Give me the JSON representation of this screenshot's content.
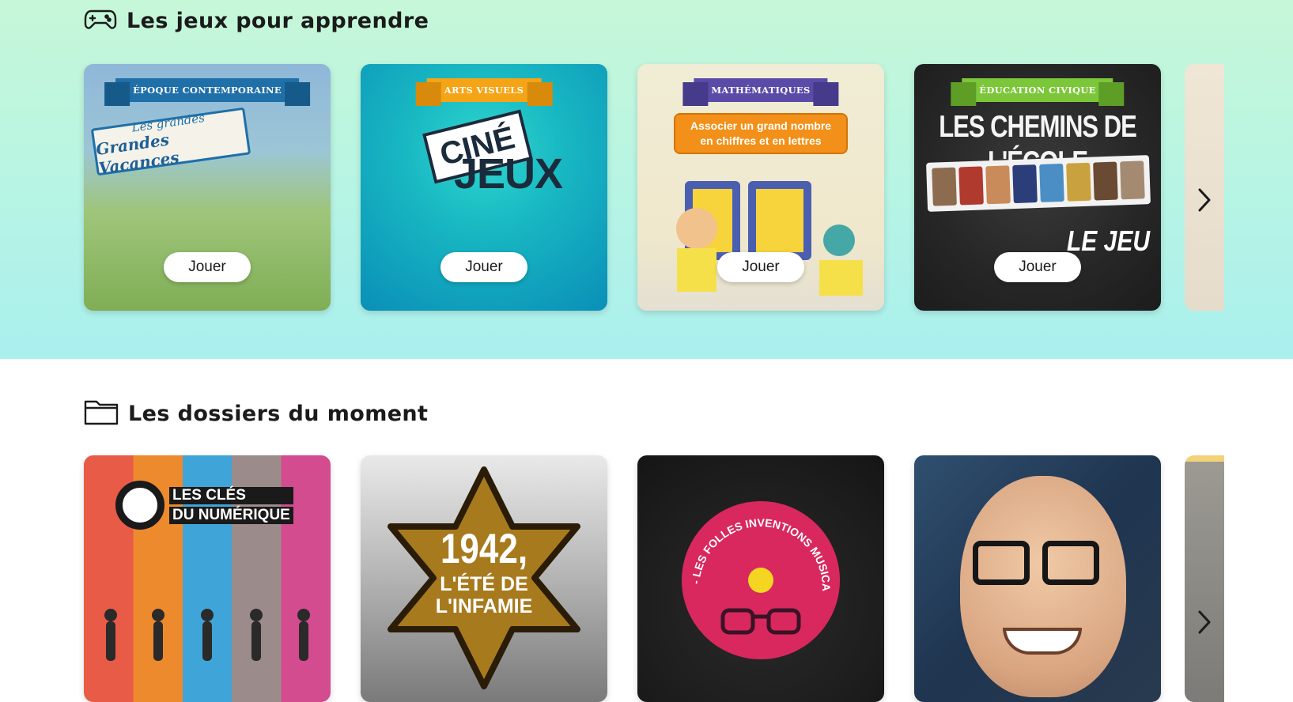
{
  "games": {
    "title": "Les jeux pour apprendre",
    "play_label": "Jouer",
    "cards": [
      {
        "category": "ÉPOQUE CONTEMPORAINE",
        "line1": "Les grandes",
        "line2": "Grandes Vacances"
      },
      {
        "category": "ARTS VISUELS",
        "word1": "CINÉ",
        "word2": "JEUX"
      },
      {
        "category": "MATHÉMATIQUES",
        "line1": "Associer un grand nombre",
        "line2": "en chiffres et en lettres"
      },
      {
        "category": "ÉDUCATION CIVIQUE",
        "title": "LES CHEMINS DE L'ÉCOLE",
        "subtitle": "LE JEU"
      }
    ]
  },
  "dossiers": {
    "title": "Les dossiers du moment",
    "cards": [
      {
        "line1": "LES CLÉS",
        "line2": "DU NUMÉRIQUE"
      },
      {
        "year": "1942,",
        "line1": "L'ÉTÉ DE",
        "line2": "L'INFAMIE"
      },
      {
        "curved": "- LES FOLLES INVENTIONS MUSICALES - AVEC PV NOVA"
      },
      {
        "alt": "portrait"
      }
    ]
  },
  "icons": {
    "games": "gamepad-icon",
    "dossiers": "folder-icon",
    "next": "chevron-right-icon"
  },
  "colors": {
    "games_bg_top": "#c6f7d8",
    "games_bg_bottom": "#aaf0ee",
    "text": "#1b1b1b"
  }
}
